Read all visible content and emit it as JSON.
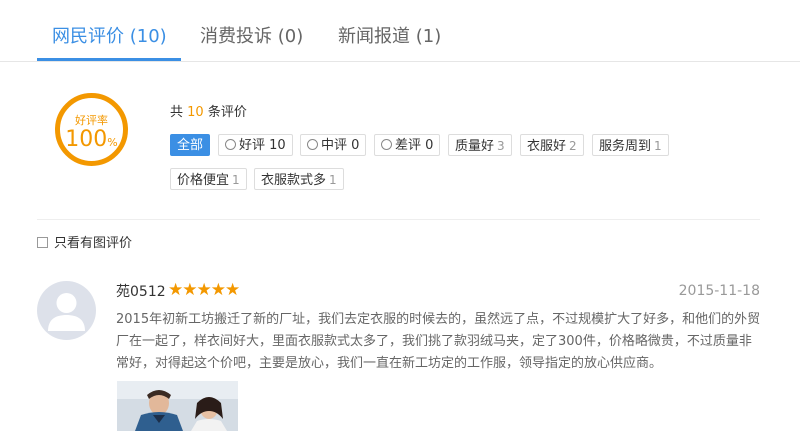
{
  "tabs": [
    {
      "label": "网民评价 (10)",
      "active": true
    },
    {
      "label": "消费投诉 (0)",
      "active": false
    },
    {
      "label": "新闻报道 (1)",
      "active": false
    }
  ],
  "rating": {
    "label": "好评率",
    "value": "100",
    "unit": "%"
  },
  "summary": {
    "prefix": "共",
    "count": "10",
    "suffix": "条评价"
  },
  "tags": [
    {
      "label": "全部",
      "count": "",
      "active": true,
      "face": ""
    },
    {
      "label": "好评",
      "count": "10",
      "active": false,
      "face": "smile-icon"
    },
    {
      "label": "中评",
      "count": "0",
      "active": false,
      "face": "neutral-face-icon"
    },
    {
      "label": "差评",
      "count": "0",
      "active": false,
      "face": "frown-icon"
    },
    {
      "label": "质量好",
      "count": "3",
      "active": false,
      "face": ""
    },
    {
      "label": "衣服好",
      "count": "2",
      "active": false,
      "face": ""
    },
    {
      "label": "服务周到",
      "count": "1",
      "active": false,
      "face": ""
    },
    {
      "label": "价格便宜",
      "count": "1",
      "active": false,
      "face": ""
    },
    {
      "label": "衣服款式多",
      "count": "1",
      "active": false,
      "face": ""
    }
  ],
  "filter": {
    "label": "只看有图评价",
    "checked": false
  },
  "review": {
    "username": "苑0512",
    "stars": "★★★★★",
    "rating": 5,
    "date": "2015-11-18",
    "text": "2015年初新工坊搬迁了新的厂址，我们去定衣服的时候去的，虽然远了点，不过规模扩大了好多，和他们的外贸厂在一起了，样衣间好大，里面衣服款式太多了，我们挑了款羽绒马夹，定了300件，价格略微贵，不过质量非常好，对得起这个价吧，主要是放心，我们一直在新工坊定的工作服，领导指定的放心供应商。"
  },
  "colors": {
    "accent": "#3b8fe4",
    "orange": "#f39800"
  }
}
